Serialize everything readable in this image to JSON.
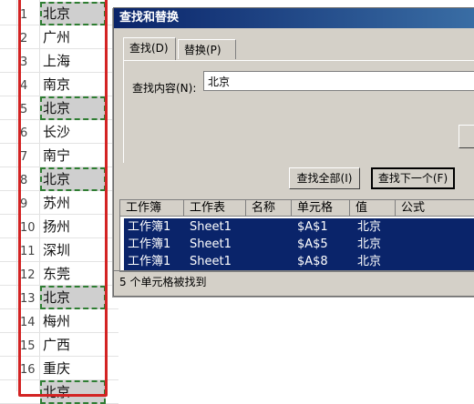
{
  "sheet": {
    "rows": [
      {
        "num": "1",
        "city": "北京",
        "found": true
      },
      {
        "num": "2",
        "city": "广州",
        "found": false
      },
      {
        "num": "3",
        "city": "上海",
        "found": false
      },
      {
        "num": "4",
        "city": "南京",
        "found": false
      },
      {
        "num": "5",
        "city": "北京",
        "found": true
      },
      {
        "num": "6",
        "city": "长沙",
        "found": false
      },
      {
        "num": "7",
        "city": "南宁",
        "found": false
      },
      {
        "num": "8",
        "city": "北京",
        "found": true
      },
      {
        "num": "9",
        "city": "苏州",
        "found": false
      },
      {
        "num": "10",
        "city": "扬州",
        "found": false
      },
      {
        "num": "11",
        "city": "深圳",
        "found": false
      },
      {
        "num": "12",
        "city": "东莞",
        "found": false
      },
      {
        "num": "13",
        "city": "北京",
        "found": true
      },
      {
        "num": "14",
        "city": "梅州",
        "found": false
      },
      {
        "num": "15",
        "city": "广西",
        "found": false
      },
      {
        "num": "16",
        "city": "重庆",
        "found": false
      },
      {
        "num": "",
        "city": "北京",
        "found": true
      }
    ]
  },
  "dialog": {
    "title": "查找和替换",
    "tabs": [
      "查找(D)",
      "替换(P)"
    ],
    "find_label": "查找内容(N):",
    "find_value": "北京",
    "find_all_button": "查找全部(I)",
    "find_next_button": "查找下一个(F)",
    "columns": [
      "工作簿",
      "工作表",
      "名称",
      "单元格",
      "值",
      "公式"
    ],
    "results": [
      {
        "book": "工作簿1",
        "sheet": "Sheet1",
        "name": "",
        "cell": "$A$1",
        "value": "北京"
      },
      {
        "book": "工作簿1",
        "sheet": "Sheet1",
        "name": "",
        "cell": "$A$5",
        "value": "北京"
      },
      {
        "book": "工作簿1",
        "sheet": "Sheet1",
        "name": "",
        "cell": "$A$8",
        "value": "北京"
      }
    ],
    "status": "5 个单元格被找到"
  },
  "colors": {
    "selection": "#0a246a",
    "highlight_box": "#d32323",
    "found_dash": "#2e7d32"
  }
}
